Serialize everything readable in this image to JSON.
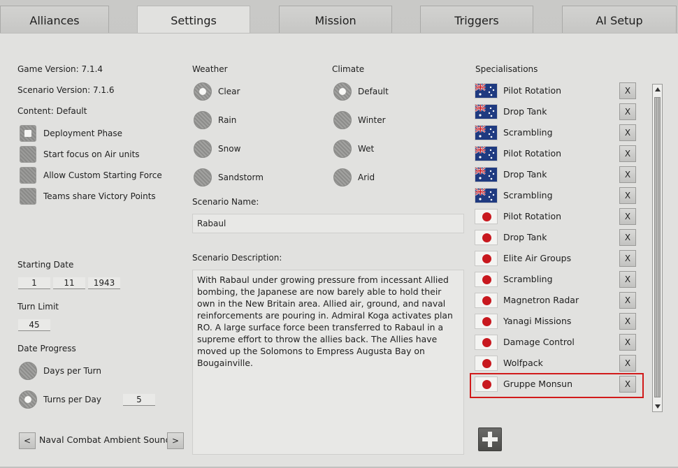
{
  "tabs": [
    "Alliances",
    "Settings",
    "Mission",
    "Triggers",
    "AI Setup"
  ],
  "info": {
    "game_version": "Game Version: 7.1.4",
    "scenario_version": "Scenario Version: 7.1.6",
    "content": "Content: Default"
  },
  "options": {
    "deployment_phase": "Deployment Phase",
    "start_focus_air": "Start focus on Air units",
    "allow_custom_force": "Allow Custom Starting Force",
    "teams_share_vp": "Teams share Victory Points"
  },
  "starting_date": {
    "label": "Starting Date",
    "day": "1",
    "month": "11",
    "year": "1943"
  },
  "turn_limit": {
    "label": "Turn Limit",
    "value": "45"
  },
  "date_progress": {
    "label": "Date Progress",
    "days_per_turn": "Days per Turn",
    "turns_per_day": "Turns per Day",
    "turns_per_day_value": "5"
  },
  "ambient": {
    "prev": "<",
    "label": "Naval Combat Ambient Sound",
    "next": ">"
  },
  "weather": {
    "label": "Weather",
    "options": [
      "Clear",
      "Rain",
      "Snow",
      "Sandstorm"
    ],
    "selected": "Clear"
  },
  "climate": {
    "label": "Climate",
    "options": [
      "Default",
      "Winter",
      "Wet",
      "Arid"
    ],
    "selected": "Default"
  },
  "scenario": {
    "name_label": "Scenario Name:",
    "name": "Rabaul",
    "description_label": "Scenario Description:",
    "description": "With Rabaul under growing pressure from incessant Allied bombing, the Japanese are now barely able to hold their own in the New Britain area. Allied air, ground, and naval reinforcements are pouring in. Admiral Koga activates plan RO. A large surface force been transferred to Rabaul in a supreme effort to throw the allies back. The Allies have moved up the Solomons to Empress Augusta Bay on Bougainville."
  },
  "specialisations": {
    "label": "Specialisations",
    "remove_label": "X",
    "items": [
      {
        "flag": "australia",
        "label": "Pilot Rotation"
      },
      {
        "flag": "australia",
        "label": "Drop Tank"
      },
      {
        "flag": "australia",
        "label": "Scrambling"
      },
      {
        "flag": "australia",
        "label": "Pilot Rotation"
      },
      {
        "flag": "australia",
        "label": "Drop Tank"
      },
      {
        "flag": "australia",
        "label": "Scrambling"
      },
      {
        "flag": "japan",
        "label": "Pilot Rotation"
      },
      {
        "flag": "japan",
        "label": "Drop Tank"
      },
      {
        "flag": "japan",
        "label": "Elite Air Groups"
      },
      {
        "flag": "japan",
        "label": "Scrambling"
      },
      {
        "flag": "japan",
        "label": "Magnetron Radar"
      },
      {
        "flag": "japan",
        "label": "Yanagi Missions"
      },
      {
        "flag": "japan",
        "label": "Damage Control"
      },
      {
        "flag": "japan",
        "label": "Wolfpack"
      },
      {
        "flag": "japan",
        "label": "Gruppe Monsun"
      }
    ]
  },
  "colors": {
    "highlight": "#d11a1a",
    "japan_red": "#c8181e",
    "aus_blue": "#223a7a"
  }
}
